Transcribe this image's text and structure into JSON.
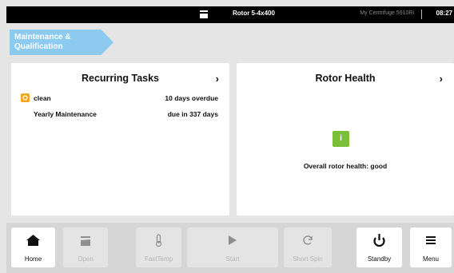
{
  "status_bar": {
    "rotor_name": "Rotor 5-4x400",
    "device_name": "My Centrifuge 5910Ri",
    "time": "08:27"
  },
  "breadcrumb": {
    "line1": "Maintenance &",
    "line2": "Qualification"
  },
  "recurring_tasks": {
    "title": "Recurring Tasks",
    "tasks": [
      {
        "name": "clean",
        "status": "10 days overdue"
      },
      {
        "name": "Yearly Maintenance",
        "status": "due in 337 days"
      }
    ]
  },
  "rotor_health": {
    "title": "Rotor Health",
    "summary": "Overall rotor health: good"
  },
  "toolbar": {
    "buttons": [
      {
        "label": "Home",
        "icon": "home-icon",
        "enabled": true
      },
      {
        "label": "Open",
        "icon": "lid-icon",
        "enabled": false
      },
      {
        "label": "FastTemp",
        "icon": "thermometer-icon",
        "enabled": false
      },
      {
        "label": "Start",
        "icon": "play-icon",
        "enabled": false
      },
      {
        "label": "Short Spin",
        "icon": "refresh-icon",
        "enabled": false
      },
      {
        "label": "Standby",
        "icon": "power-icon",
        "enabled": true
      },
      {
        "label": "Menu",
        "icon": "hamburger-icon",
        "enabled": true
      }
    ]
  },
  "colors": {
    "breadcrumb": "#8dcaf0",
    "warning": "#f4a819",
    "ok": "#7bbf39",
    "status_bar": "#000000"
  }
}
